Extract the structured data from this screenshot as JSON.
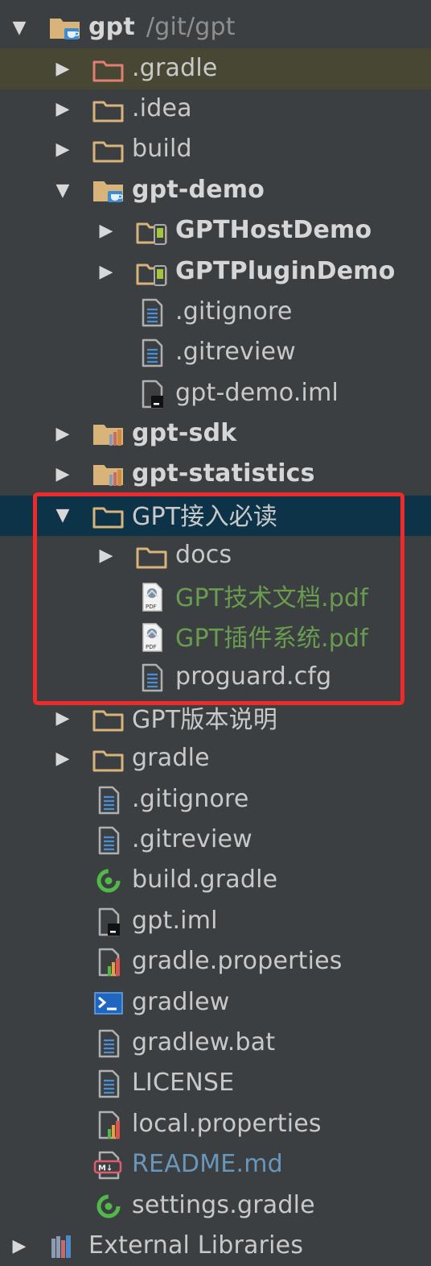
{
  "tree": [
    {
      "indent": 0,
      "expanded": true,
      "type": "module-folder",
      "icon": "module-folder-icon",
      "label": "gpt",
      "sub": "/git/gpt",
      "bold": true,
      "row": "highlight-none"
    },
    {
      "indent": 1,
      "expanded": false,
      "type": "folder",
      "icon": "excluded-folder-icon",
      "label": ".gradle",
      "row": "highlight"
    },
    {
      "indent": 1,
      "expanded": false,
      "type": "folder",
      "icon": "folder-icon",
      "label": ".idea"
    },
    {
      "indent": 1,
      "expanded": false,
      "type": "folder",
      "icon": "folder-icon",
      "label": "build"
    },
    {
      "indent": 1,
      "expanded": true,
      "type": "module-folder",
      "icon": "module-folder-icon",
      "label": "gpt-demo",
      "bold": true
    },
    {
      "indent": 2,
      "expanded": false,
      "type": "android-folder",
      "icon": "android-module-icon",
      "label": "GPTHostDemo",
      "bold": true
    },
    {
      "indent": 2,
      "expanded": false,
      "type": "android-folder",
      "icon": "android-module-icon",
      "label": "GPTPluginDemo",
      "bold": true
    },
    {
      "indent": 2,
      "type": "text-file",
      "icon": "text-file-icon",
      "label": ".gitignore"
    },
    {
      "indent": 2,
      "type": "text-file",
      "icon": "text-file-icon",
      "label": ".gitreview"
    },
    {
      "indent": 2,
      "type": "iml-file",
      "icon": "iml-file-icon",
      "label": "gpt-demo.iml"
    },
    {
      "indent": 1,
      "expanded": false,
      "type": "lib-folder",
      "icon": "library-module-icon",
      "label": "gpt-sdk",
      "bold": true
    },
    {
      "indent": 1,
      "expanded": false,
      "type": "lib-folder",
      "icon": "library-module-icon",
      "label": "gpt-statistics",
      "bold": true
    },
    {
      "indent": 1,
      "expanded": true,
      "type": "folder",
      "icon": "folder-icon",
      "label": "GPT接入必读",
      "row": "selected"
    },
    {
      "indent": 2,
      "expanded": false,
      "type": "folder",
      "icon": "folder-icon",
      "label": "docs"
    },
    {
      "indent": 2,
      "type": "pdf-file",
      "icon": "pdf-file-icon",
      "label": "GPT技术文档.pdf",
      "color": "green"
    },
    {
      "indent": 2,
      "type": "pdf-file",
      "icon": "pdf-file-icon",
      "label": "GPT插件系统.pdf",
      "color": "green"
    },
    {
      "indent": 2,
      "type": "text-file",
      "icon": "text-file-icon",
      "label": "proguard.cfg"
    },
    {
      "indent": 1,
      "expanded": false,
      "type": "folder",
      "icon": "folder-icon",
      "label": "GPT版本说明"
    },
    {
      "indent": 1,
      "expanded": false,
      "type": "folder",
      "icon": "folder-icon",
      "label": "gradle"
    },
    {
      "indent": 1,
      "type": "text-file",
      "icon": "text-file-icon",
      "label": ".gitignore"
    },
    {
      "indent": 1,
      "type": "text-file",
      "icon": "text-file-icon",
      "label": ".gitreview"
    },
    {
      "indent": 1,
      "type": "gradle-file",
      "icon": "gradle-file-icon",
      "label": "build.gradle"
    },
    {
      "indent": 1,
      "type": "iml-file",
      "icon": "iml-file-icon",
      "label": "gpt.iml"
    },
    {
      "indent": 1,
      "type": "properties-file",
      "icon": "properties-file-icon",
      "label": "gradle.properties"
    },
    {
      "indent": 1,
      "type": "shell-file",
      "icon": "shell-script-icon",
      "label": "gradlew"
    },
    {
      "indent": 1,
      "type": "text-file",
      "icon": "text-file-icon",
      "label": "gradlew.bat"
    },
    {
      "indent": 1,
      "type": "text-file",
      "icon": "text-file-icon",
      "label": "LICENSE"
    },
    {
      "indent": 1,
      "type": "properties-file",
      "icon": "properties-file-icon",
      "label": "local.properties"
    },
    {
      "indent": 1,
      "type": "markdown-file",
      "icon": "markdown-file-icon",
      "label": "README.md",
      "color": "blue"
    },
    {
      "indent": 1,
      "type": "gradle-file",
      "icon": "gradle-file-icon",
      "label": "settings.gradle"
    },
    {
      "indent": 0,
      "expanded": false,
      "type": "ext-libs",
      "icon": "external-libraries-icon",
      "label": "External Libraries"
    }
  ],
  "colors": {
    "background": "#3c3f41",
    "selected_row": "#0d3349",
    "highlight_row": "#484734",
    "folder": "#d8b37a",
    "pdf_label": "#6a9c4f",
    "markdown_label": "#6897bb",
    "annotation_box": "#ee2b2b"
  }
}
